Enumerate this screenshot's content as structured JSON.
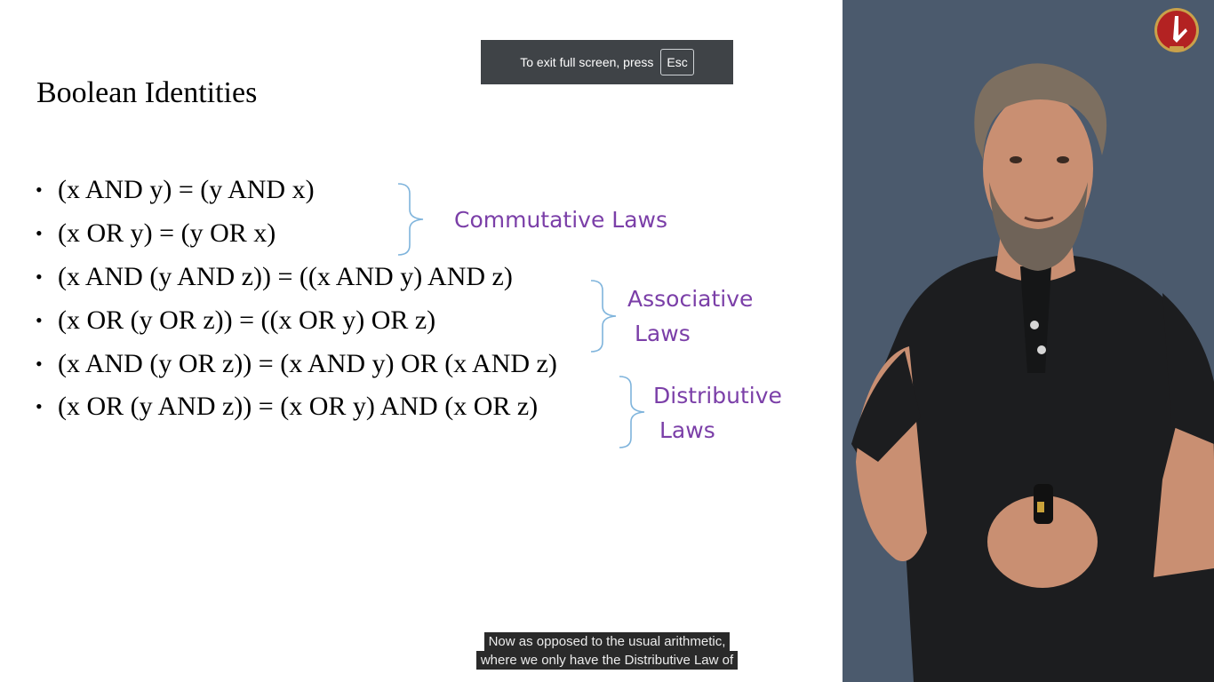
{
  "slide": {
    "title": "Boolean Identities",
    "bullets": [
      "(x AND y) = (y AND x)",
      "(x OR y) = (y OR x)",
      "(x AND (y AND z)) = ((x AND y) AND z)",
      "(x OR (y OR z)) = ((x OR y) OR z)",
      "(x AND (y OR z)) = (x AND y) OR (x AND z)",
      "(x OR (y AND z)) = (x OR y) AND (x OR z)"
    ],
    "bullet_symbol": "•",
    "groups": {
      "commutative": "Commutative Laws",
      "associative": [
        "Associative",
        "Laws"
      ],
      "distributive": [
        "Distributive",
        "Laws"
      ]
    },
    "label_color": "#7b3fa8",
    "brace_color": "#7fb4dc"
  },
  "fullscreen_notice": {
    "text": "To exit full screen, press",
    "key": "Esc"
  },
  "captions": [
    "Now as opposed to the usual arithmetic,",
    "where we only have the Distributive Law of"
  ],
  "video": {
    "background_color": "#4b5a6d",
    "logo_icon": "university-seal-icon"
  }
}
